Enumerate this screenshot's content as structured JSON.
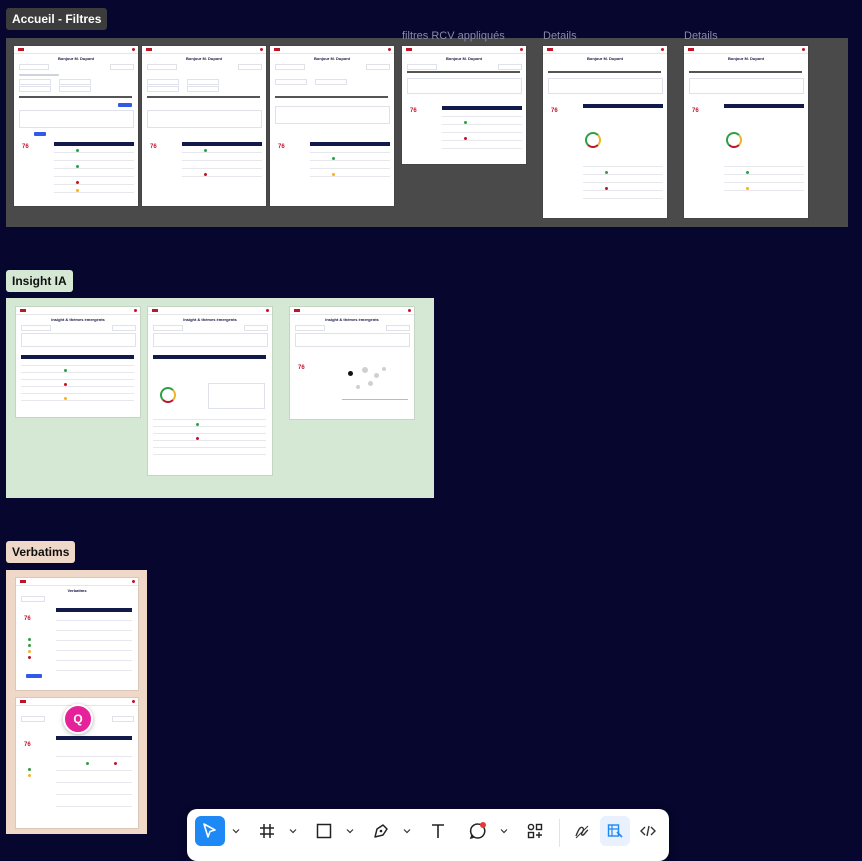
{
  "sections": [
    {
      "label": "Accueil - Filtres",
      "bg": "#4a4a4a",
      "label_bg": "#3c3c3c",
      "label_color": "#ffffff"
    },
    {
      "label": "Insight IA",
      "bg": "#d5e8d4",
      "label_bg": "#d5e8d4",
      "label_color": "#101010"
    },
    {
      "label": "Verbatims",
      "bg": "#f0d8c8",
      "label_bg": "#f0d8c8",
      "label_color": "#101010"
    }
  ],
  "frame_titles": {
    "filtres_rcv": "filtres RCV appliqués",
    "details_1": "Details",
    "details_2": "Details"
  },
  "thumb_titles": {
    "accueil": "Bonjour M. Dupont",
    "insight": "Insight & thèmes émergents",
    "verbatims": "Verbatims"
  },
  "collaborator": {
    "initial": "Q",
    "color": "#e6229a"
  },
  "toolbar": {
    "tools": [
      "move-tool",
      "frame-tool",
      "shape-tool",
      "pen-tool",
      "text-tool",
      "comment-tool",
      "actions-tool",
      "draw-mode",
      "design-mode",
      "dev-mode"
    ],
    "active_tool": "move-tool",
    "active_mode": "design-mode",
    "accent": "#1e88f5"
  }
}
